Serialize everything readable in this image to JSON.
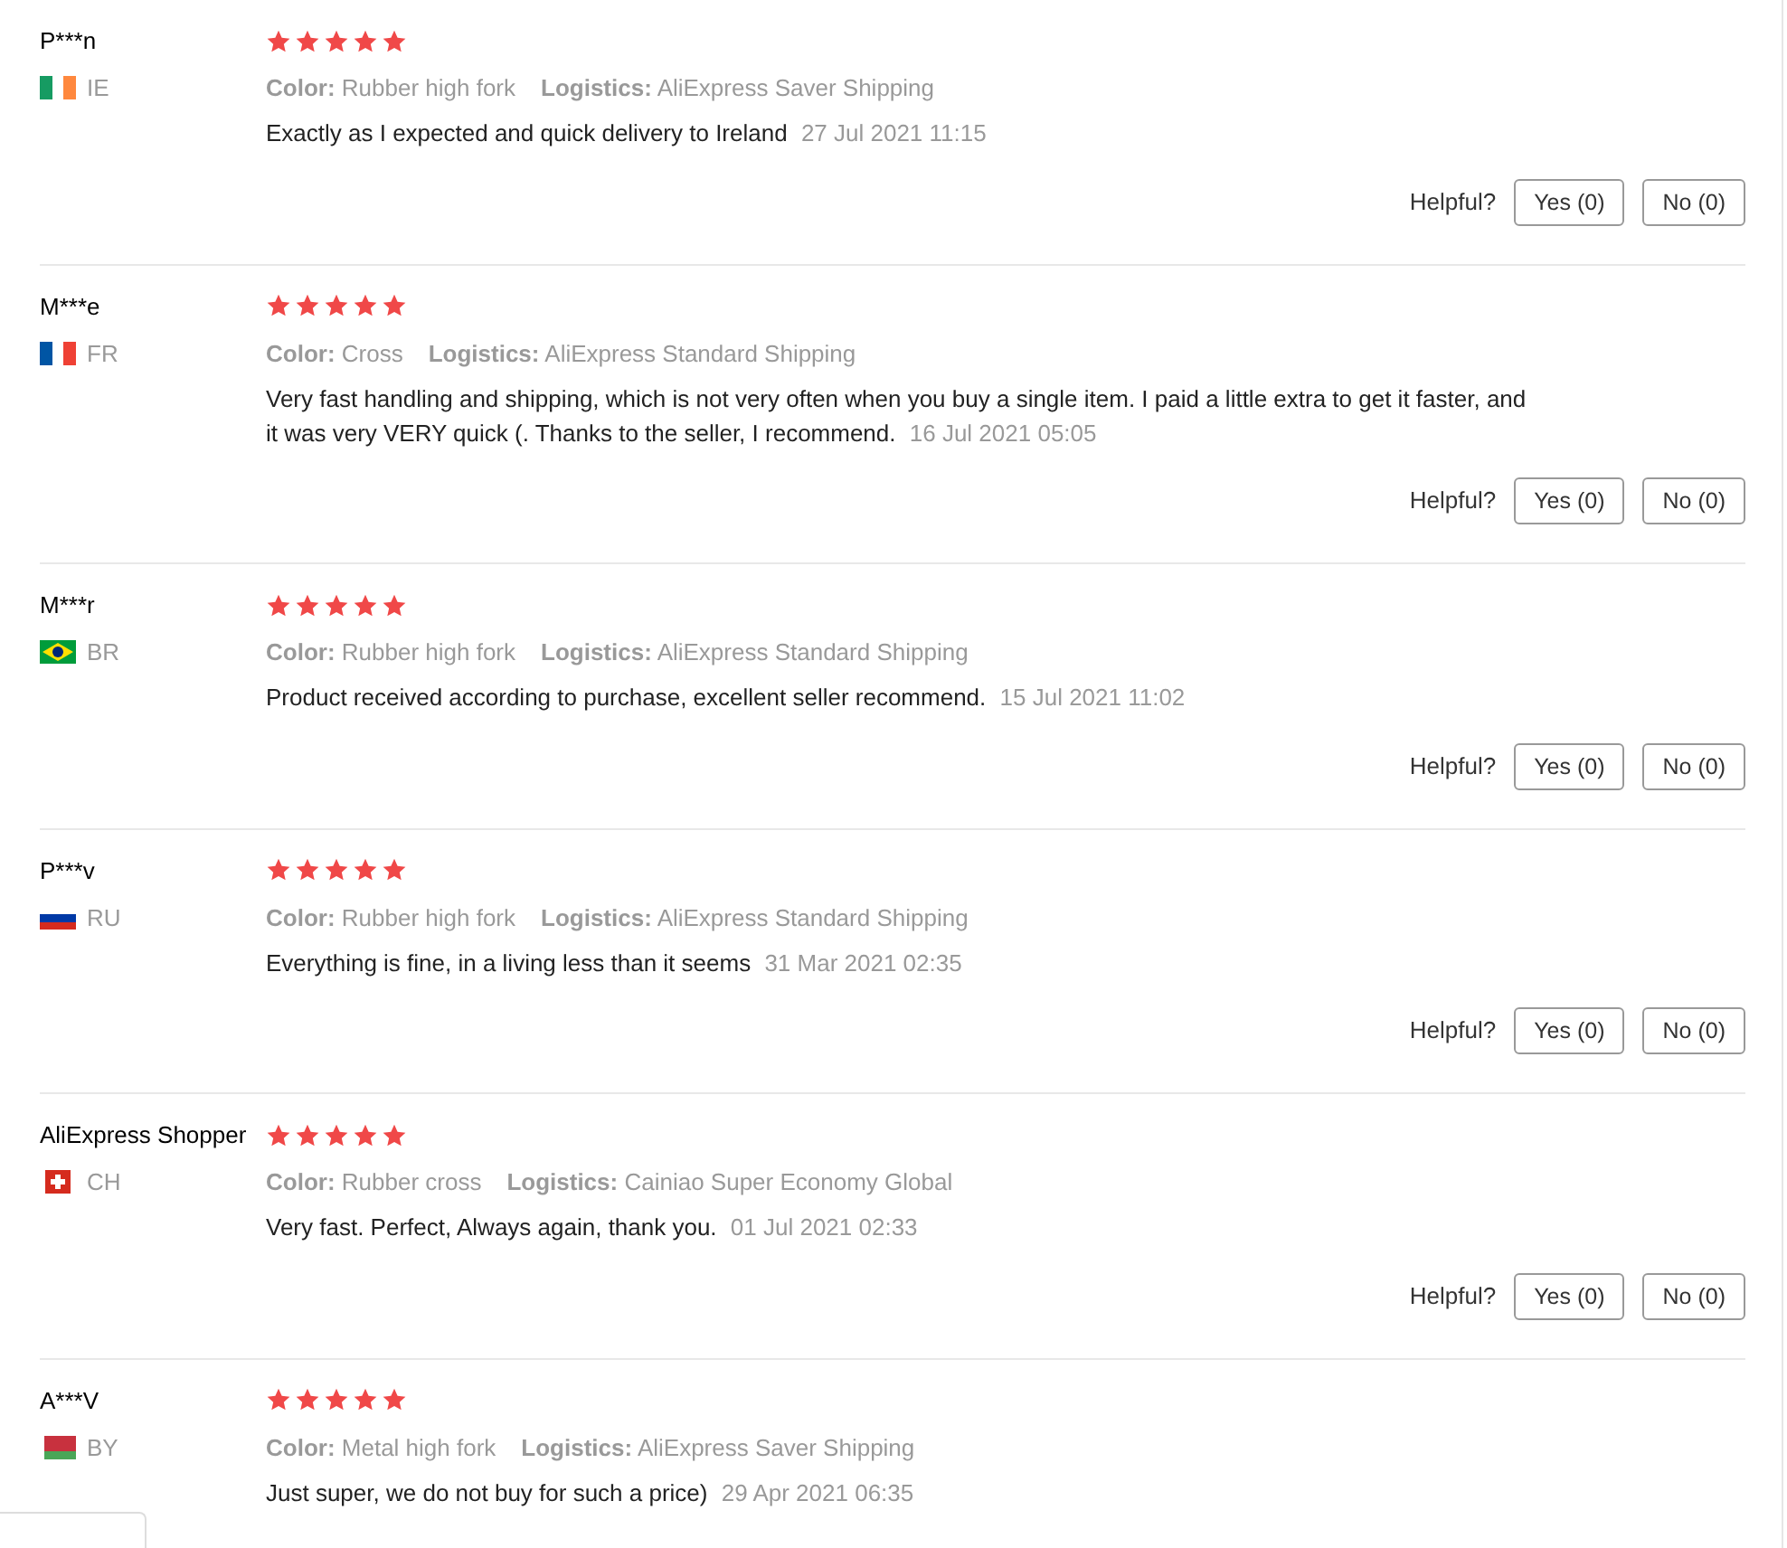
{
  "reviews": [
    {
      "name": "P***n",
      "country": "IE",
      "flag": {
        "kind": "irish"
      },
      "stars": 5,
      "color_label": "Color:",
      "color_value": "Rubber high fork",
      "logistics_label": "Logistics:",
      "logistics_value": "AliExpress Saver Shipping",
      "text": "Exactly as I expected and quick delivery to Ireland",
      "date": "27 Jul 2021 11:15",
      "helpful": {
        "label": "Helpful?",
        "yes": "Yes (0)",
        "no": "No (0)"
      }
    },
    {
      "name": "M***e",
      "country": "FR",
      "flag": {
        "kind": "french"
      },
      "stars": 5,
      "color_label": "Color:",
      "color_value": "Cross",
      "logistics_label": "Logistics:",
      "logistics_value": "AliExpress Standard Shipping",
      "text": "Very fast handling and shipping, which is not very often when you buy a single item. I paid a little extra to get it faster, and it was very VERY quick (. Thanks to the seller, I recommend.",
      "date": "16 Jul 2021 05:05",
      "helpful": {
        "label": "Helpful?",
        "yes": "Yes (0)",
        "no": "No (0)"
      }
    },
    {
      "name": "M***r",
      "country": "BR",
      "flag": {
        "kind": "brazilian"
      },
      "stars": 5,
      "color_label": "Color:",
      "color_value": "Rubber high fork",
      "logistics_label": "Logistics:",
      "logistics_value": "AliExpress Standard Shipping",
      "text": "Product received according to purchase, excellent seller recommend.",
      "date": "15 Jul 2021 11:02",
      "helpful": {
        "label": "Helpful?",
        "yes": "Yes (0)",
        "no": "No (0)"
      }
    },
    {
      "name": "P***v",
      "country": "RU",
      "flag": {
        "kind": "russian"
      },
      "stars": 5,
      "color_label": "Color:",
      "color_value": "Rubber high fork",
      "logistics_label": "Logistics:",
      "logistics_value": "AliExpress Standard Shipping",
      "text": "Everything is fine, in a living less than it seems",
      "date": "31 Mar 2021 02:35",
      "helpful": {
        "label": "Helpful?",
        "yes": "Yes (0)",
        "no": "No (0)"
      }
    },
    {
      "name": "AliExpress Shopper",
      "country": "CH",
      "flag": {
        "kind": "swiss"
      },
      "stars": 5,
      "color_label": "Color:",
      "color_value": "Rubber cross",
      "logistics_label": "Logistics:",
      "logistics_value": "Cainiao Super Economy Global",
      "text": "Very fast. Perfect, Always again, thank you.",
      "date": "01 Jul 2021 02:33",
      "helpful": {
        "label": "Helpful?",
        "yes": "Yes (0)",
        "no": "No (0)"
      }
    },
    {
      "name": "A***V",
      "country": "BY",
      "flag": {
        "kind": "belarusian"
      },
      "stars": 5,
      "color_label": "Color:",
      "color_value": "Metal high fork",
      "logistics_label": "Logistics:",
      "logistics_value": "AliExpress Saver Shipping",
      "text": "Just super, we do not buy for such a price)",
      "date": "29 Apr 2021 06:35"
    }
  ]
}
